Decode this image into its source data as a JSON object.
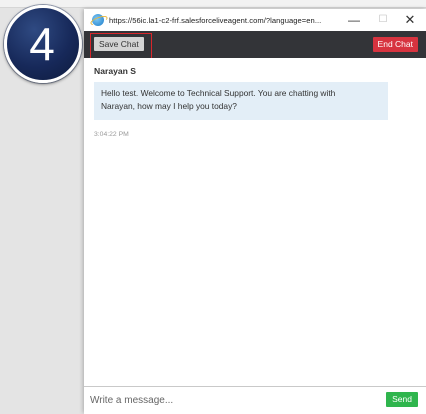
{
  "step_badge": {
    "number": "4"
  },
  "browser": {
    "url": "https://56ic.la1-c2-frf.salesforceliveagent.com/?language=en...",
    "icon": "ie-icon",
    "controls": {
      "minimize": "—",
      "maximize": "☐",
      "close": "✕"
    }
  },
  "toolbar": {
    "save_label": "Save Chat",
    "end_label": "End Chat",
    "highlight_color": "#d8262b"
  },
  "chat": {
    "agent_name": "Narayan S",
    "message_line1": "Hello test. Welcome to Technical Support. You are chatting with",
    "message_line2": "Narayan, how may I help you today?",
    "timestamp": "3:04:22 PM"
  },
  "composer": {
    "placeholder": "Write a message...",
    "send_label": "Send"
  },
  "colors": {
    "toolbar_bg": "#333438",
    "end_button": "#d7333f",
    "send_button": "#2fb54d",
    "bubble_bg": "#e3eef7"
  }
}
